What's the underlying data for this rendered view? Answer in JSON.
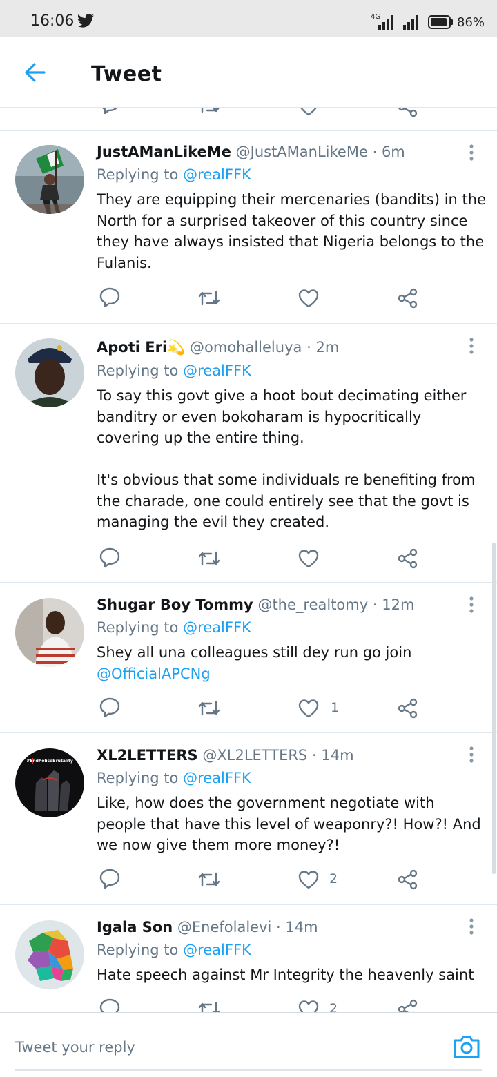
{
  "status_bar": {
    "time": "16:06",
    "network": "4G",
    "battery": "86%"
  },
  "header": {
    "title": "Tweet"
  },
  "tweets": [
    {
      "name": "JustAManLikeMe",
      "handle": "@JustAManLikeMe",
      "dot": "·",
      "ago": "6m",
      "replying_prefix": "Replying to",
      "replying_to": "@realFFK",
      "text": "They are equipping their mercenaries (bandits) in the North for a surprised takeover of this country since they have always insisted that Nigeria belongs to the Fulanis.",
      "likes": ""
    },
    {
      "name": "Apoti Eri",
      "emoji": "💫",
      "handle": "@omohalleluya",
      "dot": "·",
      "ago": "2m",
      "replying_prefix": "Replying to",
      "replying_to": "@realFFK",
      "text": "To say this govt give a hoot bout decimating either banditry or even bokoharam is hypocritically covering up the entire thing.\n\nIt's obvious that some individuals re benefiting from the charade, one could entirely see that the govt is managing the evil they created.",
      "likes": ""
    },
    {
      "name": "Shugar Boy Tommy",
      "handle": "@the_realtomy",
      "dot": "·",
      "ago": "12m",
      "replying_prefix": "Replying to",
      "replying_to": "@realFFK",
      "text": "Shey all una colleagues still dey run go join",
      "link": "@OfficialAPCNg",
      "likes": "1"
    },
    {
      "name": "XL2LETTERS",
      "handle": "@XL2LETTERS",
      "dot": "·",
      "ago": "14m",
      "replying_prefix": "Replying to",
      "replying_to": "@realFFK",
      "text": "Like, how does the government negotiate with people that have this level of weaponry?! How?! And we now give them more money?!",
      "avatar_text": "#EndPoliceBrutality",
      "likes": "2"
    },
    {
      "name": "Igala Son",
      "handle": "@Enefolalevi",
      "dot": "·",
      "ago": "14m",
      "replying_prefix": "Replying to",
      "replying_to": "@realFFK",
      "text": "Hate speech against Mr Integrity the heavenly saint",
      "likes": "2"
    }
  ],
  "composer": {
    "placeholder": "Tweet your reply"
  },
  "colors": {
    "accent": "#1da1f2",
    "secondary": "#657786",
    "text": "#14171a",
    "divider": "#e1e8ed"
  },
  "icons": [
    "back-arrow-icon",
    "reply-icon",
    "retweet-icon",
    "like-icon",
    "share-icon",
    "more-vertical-icon",
    "camera-icon",
    "twitter-bird-icon"
  ]
}
